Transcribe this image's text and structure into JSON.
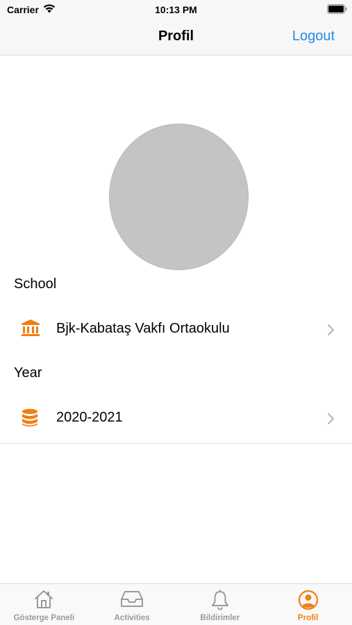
{
  "status_bar": {
    "carrier": "Carrier",
    "time": "10:13 PM"
  },
  "nav": {
    "title": "Profil",
    "logout_label": "Logout"
  },
  "profile": {
    "school_section_label": "School",
    "school_name": "Bjk-Kabataş Vakfı Ortaokulu",
    "year_section_label": "Year",
    "year_value": "2020-2021"
  },
  "tabs": [
    {
      "label": "Gösterge Paneli",
      "icon": "home-icon",
      "active": false
    },
    {
      "label": "Activities",
      "icon": "inbox-tray-icon",
      "active": false
    },
    {
      "label": "Bildirimler",
      "icon": "bell-icon",
      "active": false
    },
    {
      "label": "Profil",
      "icon": "user-circle-icon",
      "active": true
    }
  ],
  "colors": {
    "accent": "#f07f12",
    "link": "#1f8ce6",
    "inactive_tab": "#9a9a9a",
    "avatar_placeholder": "#c4c4c4"
  }
}
